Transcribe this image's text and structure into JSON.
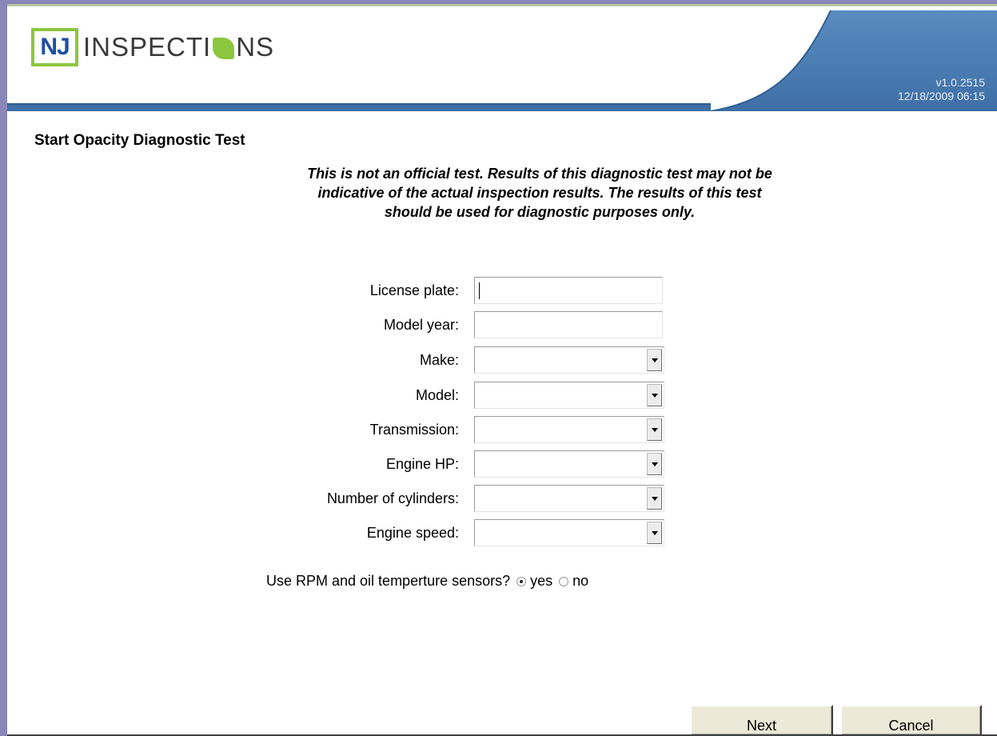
{
  "header": {
    "logo_nj": "NJ",
    "logo_text_left": "INSPECTI",
    "logo_text_right": "NS",
    "version": "v1.0.2515",
    "datetime": "12/18/2009 06:15",
    "colors": {
      "brand_green": "#8cc63f",
      "brand_blue": "#1e4fa0",
      "panel_blue": "#4b7fb6"
    }
  },
  "page": {
    "title": "Start Opacity Diagnostic Test",
    "notice_line1": "This is not an official test. Results of this diagnostic test may not be",
    "notice_line2": "indicative of the actual inspection results. The results of this test",
    "notice_line3": "should be used for diagnostic purposes only."
  },
  "form": {
    "license_plate": {
      "label": "License plate:",
      "value": ""
    },
    "model_year": {
      "label": "Model year:",
      "value": ""
    },
    "make": {
      "label": "Make:",
      "value": ""
    },
    "model": {
      "label": "Model:",
      "value": ""
    },
    "transmission": {
      "label": "Transmission:",
      "value": ""
    },
    "engine_hp": {
      "label": "Engine HP:",
      "value": ""
    },
    "num_cylinders": {
      "label": "Number of cylinders:",
      "value": ""
    },
    "engine_speed": {
      "label": "Engine speed:",
      "value": ""
    },
    "sensors": {
      "question": "Use RPM and oil temperture sensors?",
      "yes_label": "yes",
      "no_label": "no",
      "selected": "yes"
    }
  },
  "buttons": {
    "next": "Next",
    "cancel": "Cancel"
  }
}
